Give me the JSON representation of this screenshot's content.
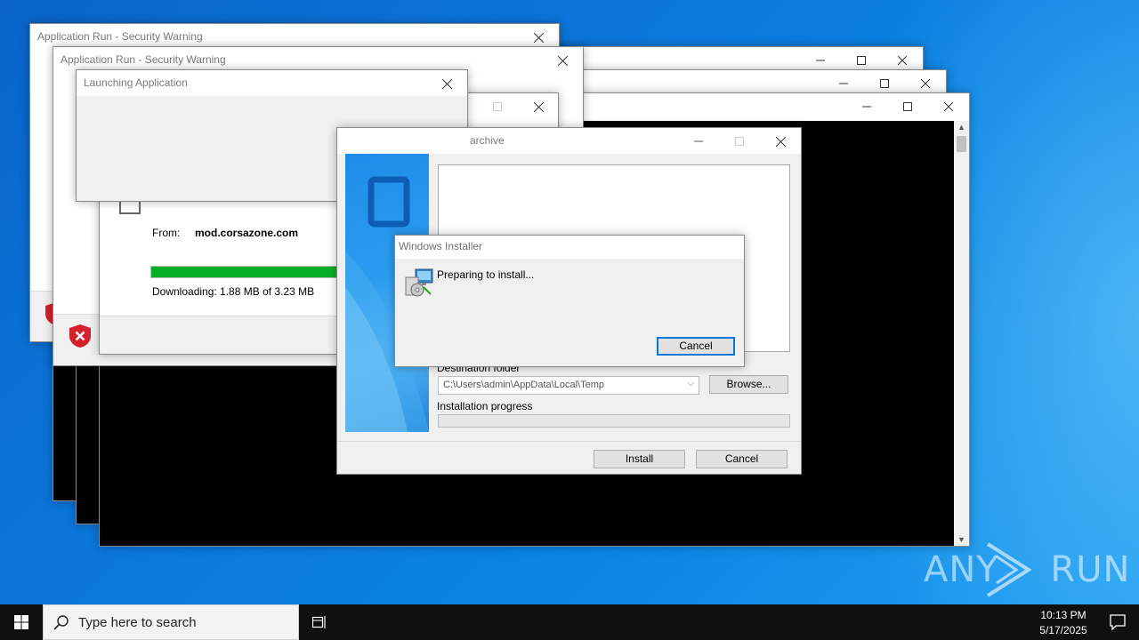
{
  "windows": {
    "security_warning_1": {
      "title": "Application Run - Security Warning"
    },
    "security_warning_2": {
      "title": "Application Run - Security Warning"
    },
    "launching": {
      "title": "Launching Application"
    },
    "download": {
      "from_label": "From:",
      "from_value": "mod.corsazone.com",
      "progress": 0.58,
      "status": "Downloading: 1.88 MB of 3.23 MB"
    },
    "archive": {
      "title_fragment": "archive",
      "destination_label": "Destination folder",
      "destination_value": "C:\\Users\\admin\\AppData\\Local\\Temp",
      "browse_label": "Browse...",
      "progress_label": "Installation progress",
      "install_label": "Install",
      "cancel_label": "Cancel"
    },
    "windows_installer": {
      "title": "Windows Installer",
      "message": "Preparing to install...",
      "cancel_label": "Cancel"
    }
  },
  "taskbar": {
    "search_placeholder": "Type here to search",
    "time": "10:13 PM",
    "date": "5/17/2025"
  },
  "watermark": {
    "text": "ANY RUN"
  },
  "colors": {
    "accent": "#0078d7",
    "progress_green": "#06b025",
    "shield_red": "#d4202a"
  },
  "icons": [
    "close-icon",
    "minimize-icon",
    "maximize-icon",
    "shield-x-icon",
    "installer-icon",
    "windows-start-icon",
    "search-icon",
    "task-view-icon",
    "notification-icon",
    "chevron-down-icon"
  ]
}
